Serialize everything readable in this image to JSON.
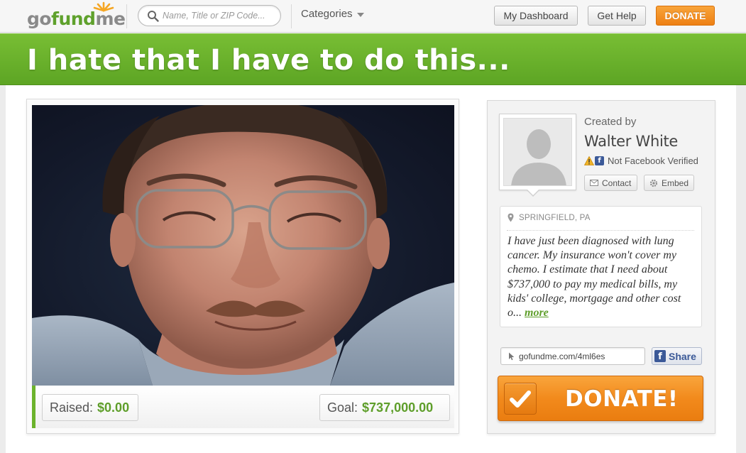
{
  "header": {
    "logo": {
      "go": "go",
      "fund": "fund",
      "me": "me"
    },
    "search_placeholder": "Name, Title or ZIP Code...",
    "categories_label": "Categories",
    "dashboard_label": "My Dashboard",
    "help_label": "Get Help",
    "donate_label": "DONATE"
  },
  "campaign": {
    "title": "I hate that I have to do this...",
    "raised_label": "Raised:",
    "raised_value": "$0.00",
    "goal_label": "Goal:",
    "goal_value": "$737,000.00"
  },
  "creator": {
    "created_by_label": "Created by",
    "name": "Walter White",
    "verification": "Not Facebook Verified",
    "contact_label": "Contact",
    "embed_label": "Embed"
  },
  "story": {
    "location": "SPRINGFIELD, PA",
    "text": "I have just been diagnosed with lung cancer. My insurance won't cover my chemo. I estimate that I need about $737,000 to pay my medical bills, my kids' college, mortgage and other cost o...",
    "more_label": "more"
  },
  "share": {
    "url": "gofundme.com/4ml6es",
    "share_label": "Share"
  },
  "donate": {
    "big_label": "DONATE!"
  },
  "colors": {
    "brand_green": "#6cb32c",
    "donate_orange": "#f28a1c",
    "facebook_blue": "#3b5998"
  },
  "icons": [
    "sun-logo-icon",
    "search-icon",
    "chevron-down-icon",
    "warning-icon",
    "facebook-icon",
    "envelope-icon",
    "gear-icon",
    "map-pin-icon",
    "cursor-icon",
    "checkmark-icon",
    "person-silhouette-icon"
  ]
}
